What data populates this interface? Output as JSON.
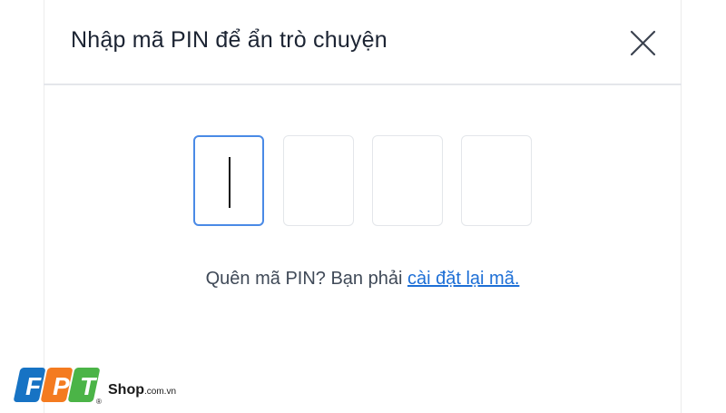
{
  "dialog": {
    "title": "Nhập mã PIN để ẩn trò chuyện",
    "close_icon": "close-icon"
  },
  "pin": {
    "digits": [
      "",
      "",
      "",
      ""
    ],
    "active_index": 0
  },
  "forgot": {
    "text": "Quên mã PIN? Bạn phải ",
    "link_label": "cài đặt lại mã."
  },
  "watermark": {
    "letters": [
      "F",
      "P",
      "T"
    ],
    "brand": "Shop",
    "domain": ".com.vn",
    "registered": "®"
  },
  "colors": {
    "active_border": "#4a8ae6",
    "link": "#1d6fd6",
    "logo_blue": "#1773c4",
    "logo_orange": "#f47b20",
    "logo_green": "#4bb447"
  }
}
